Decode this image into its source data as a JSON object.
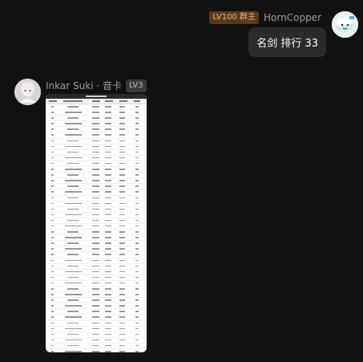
{
  "messages": {
    "outgoing": {
      "sender": "HornCopper",
      "badge": "LV100 群主",
      "text": "名剑 排行 33",
      "badge_color": "#5a3a1d"
    },
    "incoming": {
      "sender": "Inkar Suki · 音卡",
      "level": "LV3",
      "attachment": "ranking-table-image"
    }
  },
  "colors": {
    "background": "#111111",
    "bubble": "#2b2b2b",
    "owner_badge_text": "#f0b37a"
  }
}
